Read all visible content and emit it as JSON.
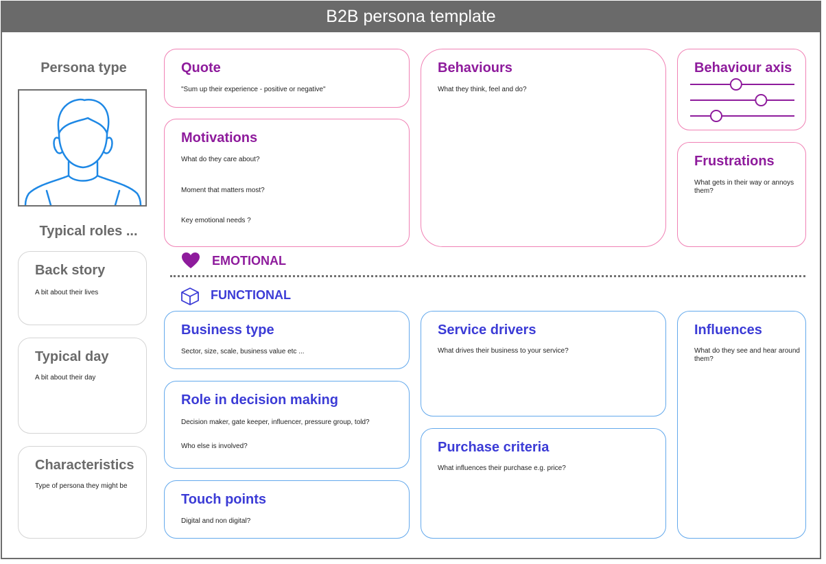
{
  "title": "B2B persona template",
  "left": {
    "persona_type": "Persona type",
    "typical_roles": "Typical roles ...",
    "back_story": {
      "title": "Back story",
      "text": "A bit about their lives"
    },
    "typical_day": {
      "title": "Typical day",
      "text": "A bit about their day"
    },
    "characteristics": {
      "title": "Characteristics",
      "text": "Type of persona they might be"
    }
  },
  "emotional": {
    "label": "EMOTIONAL",
    "color": "#8e1b9c",
    "quote": {
      "title": "Quote",
      "text": "\"Sum up their experience - positive or negative\""
    },
    "motivations": {
      "title": "Motivations",
      "q1": "What do they care about?",
      "q2": "Moment that matters most?",
      "q3": "Key emotional needs ?"
    },
    "behaviours": {
      "title": "Behaviours",
      "text": "What they think, feel and do?"
    },
    "behaviour_axis": {
      "title": "Behaviour axis",
      "slider_levels": [
        0.44,
        0.68,
        0.25
      ]
    },
    "frustrations": {
      "title": "Frustrations",
      "text": "What gets in their way or annoys them?"
    }
  },
  "functional": {
    "label": "FUNCTIONAL",
    "color": "#3b3bd6",
    "business_type": {
      "title": "Business type",
      "text": "Sector, size, scale, business value etc ..."
    },
    "role_decision": {
      "title": "Role in decision making",
      "q1": "Decision maker, gate keeper, influencer, pressure group, told?",
      "q2": "Who else is involved?"
    },
    "touch_points": {
      "title": "Touch points",
      "text": "Digital and non digital?"
    },
    "service_drivers": {
      "title": "Service drivers",
      "text": "What drives their business to your service?"
    },
    "purchase_criteria": {
      "title": "Purchase criteria",
      "text": "What influences their purchase e.g. price?"
    },
    "influences": {
      "title": "Influences",
      "text": "What do they see and hear around them?"
    }
  }
}
